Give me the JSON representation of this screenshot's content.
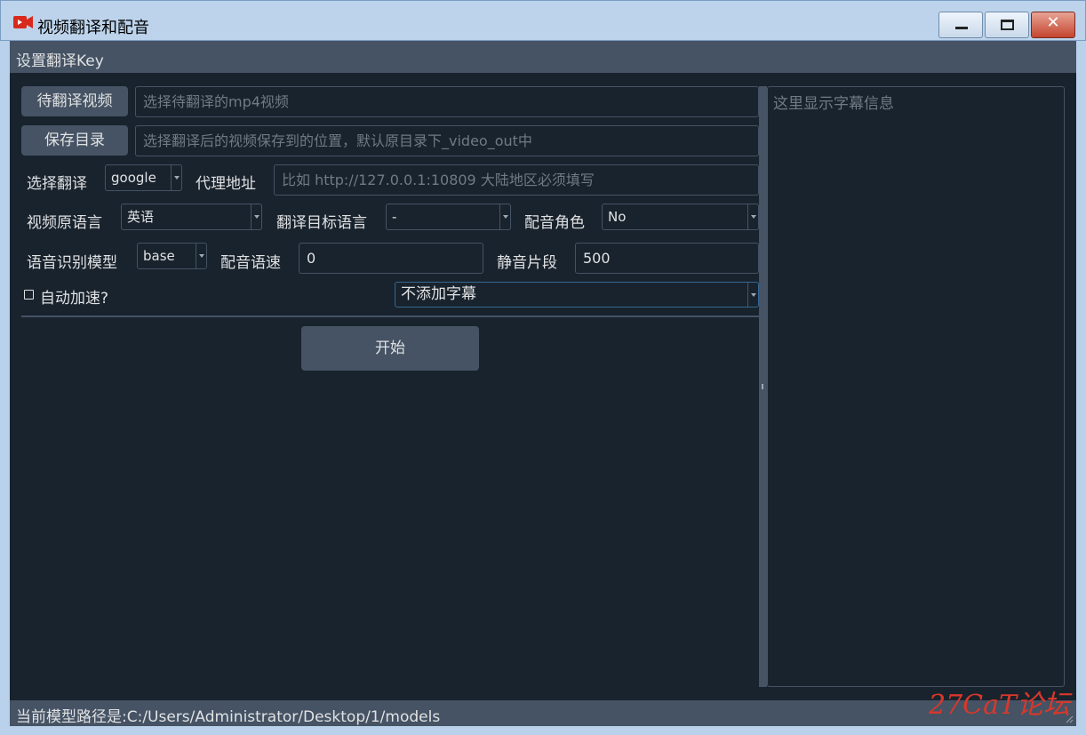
{
  "window": {
    "title": "视频翻译和配音"
  },
  "menu": {
    "items": [
      "设置翻译Key"
    ]
  },
  "form": {
    "source_button": "待翻译视频",
    "source_placeholder": "选择待翻译的mp4视频",
    "save_button": "保存目录",
    "save_placeholder": "选择翻译后的视频保存到的位置，默认原目录下_video_out中",
    "translate_label": "选择翻译",
    "translate_value": "google",
    "proxy_label": "代理地址",
    "proxy_placeholder": "比如 http://127.0.0.1:10809 大陆地区必须填写",
    "source_lang_label": "视频原语言",
    "source_lang_value": "英语",
    "target_lang_label": "翻译目标语言",
    "target_lang_value": "-",
    "voice_role_label": "配音角色",
    "voice_role_value": "No",
    "model_label": "语音识别模型",
    "model_value": "base",
    "voice_rate_label": "配音语速",
    "voice_rate_value": "0",
    "silence_label": "静音片段",
    "silence_value": "500",
    "auto_speed_label": "自动加速?",
    "auto_speed_checked": false,
    "subtitle_option_value": "不添加字幕",
    "start_button": "开始"
  },
  "log": {
    "placeholder": "这里显示字幕信息"
  },
  "status": {
    "text": "当前模型路径是:C:/Users/Administrator/Desktop/1/models"
  },
  "watermark": {
    "text": "27CaT论坛"
  },
  "colors": {
    "background": "#19232d",
    "panel": "#455364",
    "text": "#e0e1e3",
    "placeholder": "#707a85",
    "watermark": "#d9382b"
  }
}
